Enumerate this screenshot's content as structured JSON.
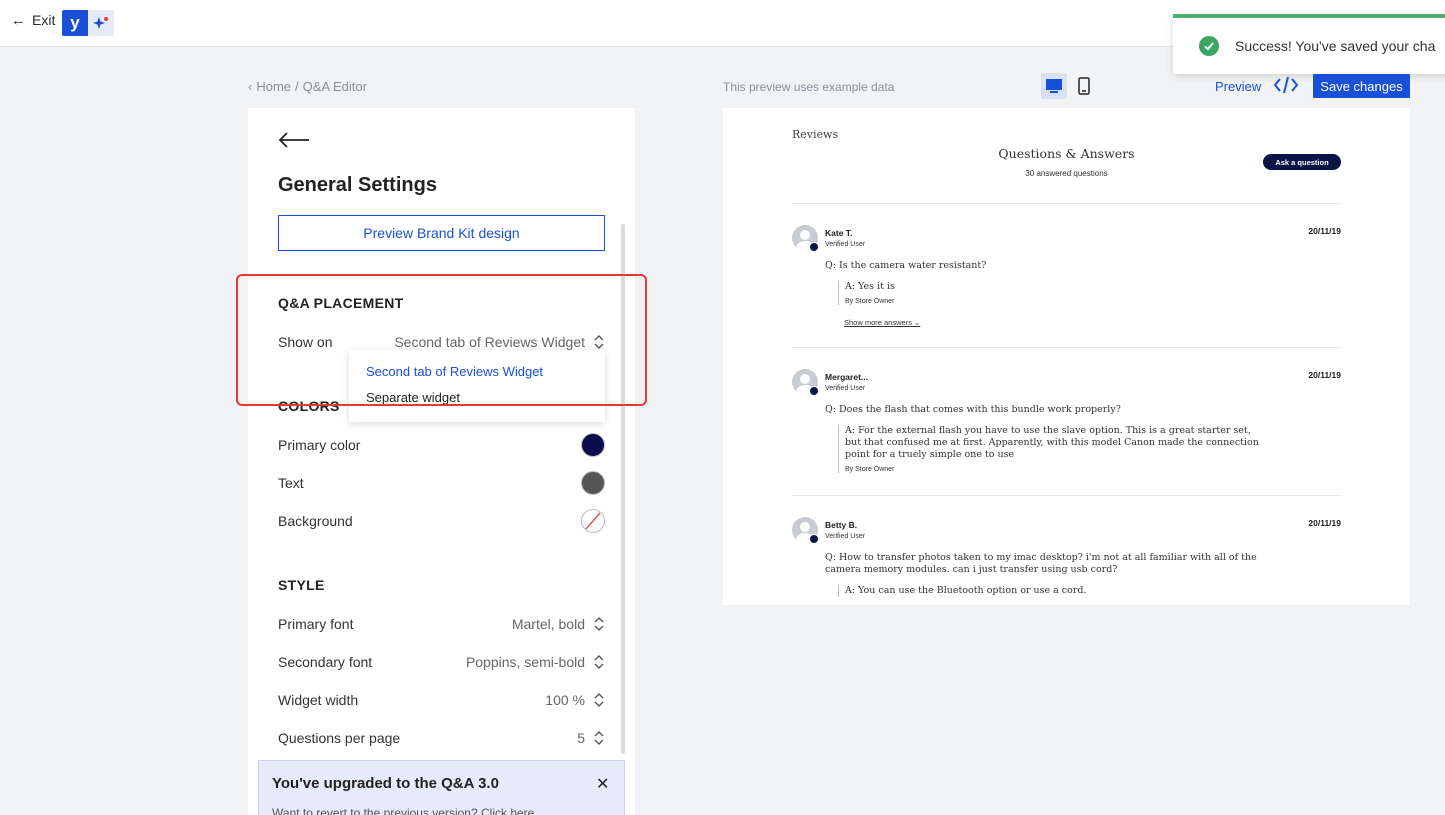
{
  "topbar": {
    "exit_label": "Exit",
    "logo_letter": "y"
  },
  "toast": {
    "message": "Success! You've saved your cha"
  },
  "breadcrumb": {
    "home": "Home",
    "separator": "/",
    "current": "Q&A Editor"
  },
  "preview_bar": {
    "note": "This preview uses example data",
    "preview_label": "Preview",
    "save_label": "Save changes"
  },
  "settings": {
    "title": "General Settings",
    "brandkit_label": "Preview Brand Kit design",
    "placement": {
      "section": "Q&A PLACEMENT",
      "show_on_label": "Show on",
      "show_on_value": "Second tab of Reviews Widget",
      "options": [
        "Second tab of Reviews Widget",
        "Separate widget"
      ]
    },
    "colors": {
      "section": "COLORS",
      "primary_label": "Primary color",
      "primary_value": "#0b0c4a",
      "text_label": "Text",
      "text_value": "#555555",
      "background_label": "Background",
      "background_value": "none"
    },
    "style": {
      "section": "STYLE",
      "primary_font_label": "Primary font",
      "primary_font_value": "Martel, bold",
      "secondary_font_label": "Secondary font",
      "secondary_font_value": "Poppins, semi-bold",
      "width_label": "Widget width",
      "width_value": "100 %",
      "per_page_label": "Questions per page",
      "per_page_value": "5"
    },
    "upgrade": {
      "title": "You've upgraded to the Q&A 3.0",
      "subtitle": "Want to revert to the previous version? Click here"
    }
  },
  "preview": {
    "reviews_label": "Reviews",
    "qa_title": "Questions & Answers",
    "count": "30 answered questions",
    "ask_label": "Ask a question",
    "questions": [
      {
        "name": "Kate T.",
        "verified": "Verified User",
        "date": "20/11/19",
        "question": "Q: Is the camera water resistant?",
        "answer": "A: Yes it is",
        "answer_by": "By Store Owner",
        "show_more": "Show more answers"
      },
      {
        "name": "Mergaret...",
        "verified": "Verified User",
        "date": "20/11/19",
        "question": "Q: Does the flash that comes with this bundle work properly?",
        "answer": "A: For the external flash you have to use the slave option. This is a great starter set, but that confused me at first. Apparently, with this model Canon made the connection point for a truely simple one to use",
        "answer_by": "By Store Owner"
      },
      {
        "name": "Betty B.",
        "verified": "Verified User",
        "date": "20/11/19",
        "question": "Q: How to transfer photos taken to my imac desktop? i'm not at all familiar with all of the camera memory modules. can i just transfer using usb cord?",
        "answer": "A: You can use the Bluetooth option or use a cord."
      }
    ]
  }
}
